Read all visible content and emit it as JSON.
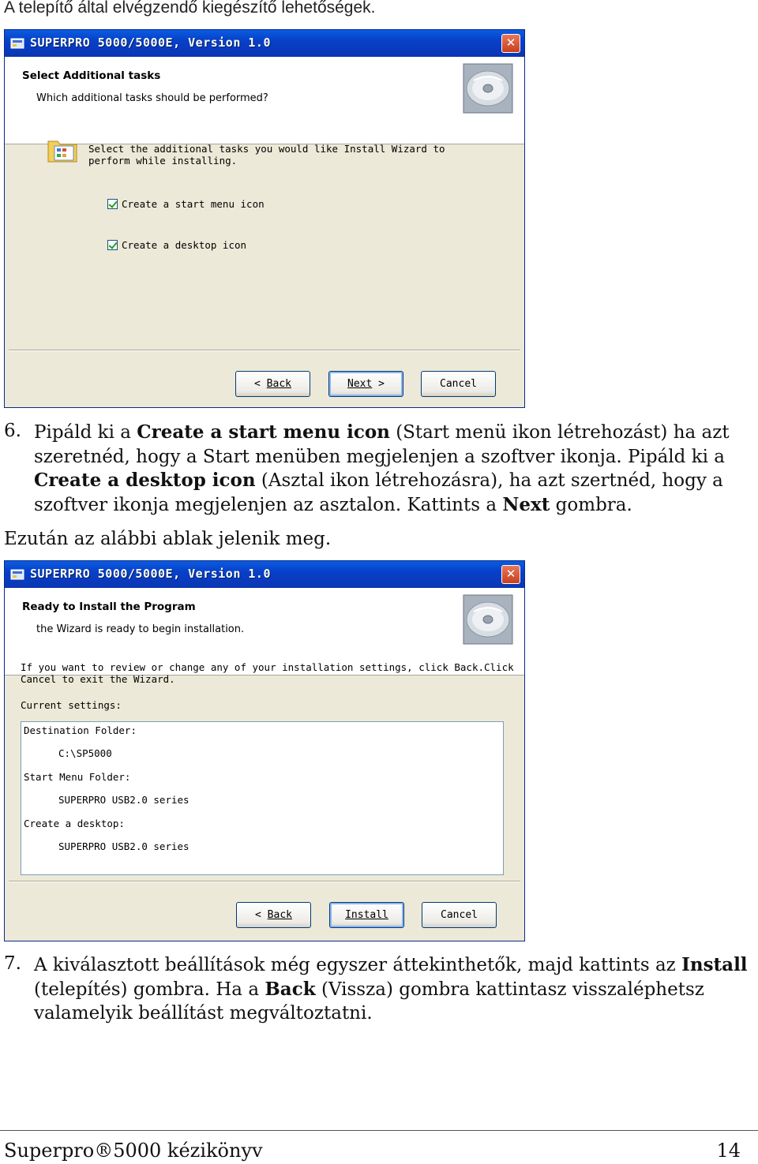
{
  "intro_text": "A telepítő által elvégzendő kiegészítő lehetőségek.",
  "dialog1": {
    "title": "SUPERPRO 5000/5000E, Version 1.0",
    "close": "✕",
    "header_title": "Select Additional tasks",
    "header_sub": "Which additional tasks should be performed?",
    "instruction_line1": "Select  the additional tasks you would like Install Wizard to",
    "instruction_line2": "perform while installing.",
    "options": [
      "Create a start menu icon",
      "Create a desktop icon"
    ],
    "buttons": {
      "back": "Back",
      "next": "Next",
      "cancel": "Cancel"
    }
  },
  "step6": {
    "number": "6.",
    "t1": "Pipáld ki a ",
    "b1": "Create a start menu icon",
    "t2": " (Start menü ikon létrehozást) ha azt szeretnéd, hogy a Start menüben megjelenjen a szoftver ikonja. Pipáld ki a ",
    "b2": "Create a desktop icon",
    "t3": " (Asztal ikon létrehozásra), ha azt szertnéd, hogy a szoftver ikonja megjelenjen az asztalon. Kattints a ",
    "b3": "Next",
    "t4": " gombra."
  },
  "after_text": "Ezután az alábbi ablak jelenik meg.",
  "dialog2": {
    "title": "SUPERPRO 5000/5000E, Version 1.0",
    "close": "✕",
    "header_title": "Ready to Install the Program",
    "header_sub": "the Wizard is ready to begin installation.",
    "info_line1": "If you want to review or change any  of your installation settings, click Back.Click",
    "info_line2": "Cancel to  exit the Wizard.",
    "current_settings": "Current settings:",
    "settings": [
      {
        "label": "Destination Folder:",
        "value": "C:\\SP5000"
      },
      {
        "label": "Start Menu Folder:",
        "value": "SUPERPRO USB2.0 series"
      },
      {
        "label": "Create a desktop:",
        "value": "SUPERPRO USB2.0 series"
      }
    ],
    "buttons": {
      "back": "Back",
      "install": "Install",
      "cancel": "Cancel"
    }
  },
  "step7": {
    "number": "7.",
    "t1": "A kiválasztott beállítások még egyszer áttekinthetők, majd kattints az ",
    "b1": "Install",
    "t2": " (telepítés) gombra. Ha a ",
    "b2": "Back",
    "t3": " (Vissza) gombra kattintasz visszaléphetsz valamelyik beállítást megváltoztatni."
  },
  "footer": {
    "left": "Superpro®5000 kézikönyv",
    "right": "14"
  }
}
